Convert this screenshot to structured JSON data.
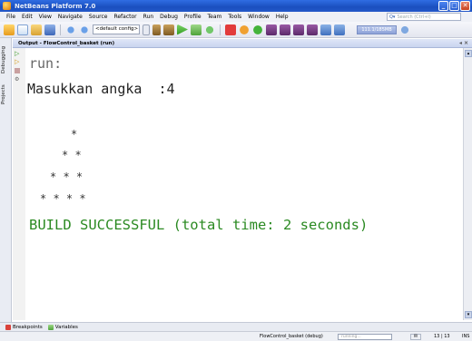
{
  "window": {
    "title": "NetBeans Platform 7.0"
  },
  "menu": [
    "File",
    "Edit",
    "View",
    "Navigate",
    "Source",
    "Refactor",
    "Run",
    "Debug",
    "Profile",
    "Team",
    "Tools",
    "Window",
    "Help"
  ],
  "search": {
    "placeholder": "Search (Ctrl+I)"
  },
  "toolbar": {
    "config_value": "<default config>",
    "memory_label": "111.1/185MB"
  },
  "side_tabs": [
    "Debugging",
    "Projects"
  ],
  "output_panel": {
    "title": "Output - FlowControl_basket (run)",
    "controls": "◂ ×"
  },
  "console": {
    "run_line": "run:",
    "input_line": "Masukkan angka  :4",
    "stars": [
      "*",
      "* *",
      "* * *",
      "* * * *"
    ],
    "build_line": "BUILD SUCCESSFUL (total time: 2 seconds)"
  },
  "bottom_tabs": [
    "Breakpoints",
    "Variables"
  ],
  "status": {
    "task": "FlowControl_basket (debug)",
    "progress_text": "running...",
    "note_icon": "✉",
    "position": "13 | 13",
    "mode": "INS"
  },
  "colors": {
    "title_bar": "#1a4fbf",
    "build_success": "#2b8a22",
    "console_text": "#333333"
  }
}
